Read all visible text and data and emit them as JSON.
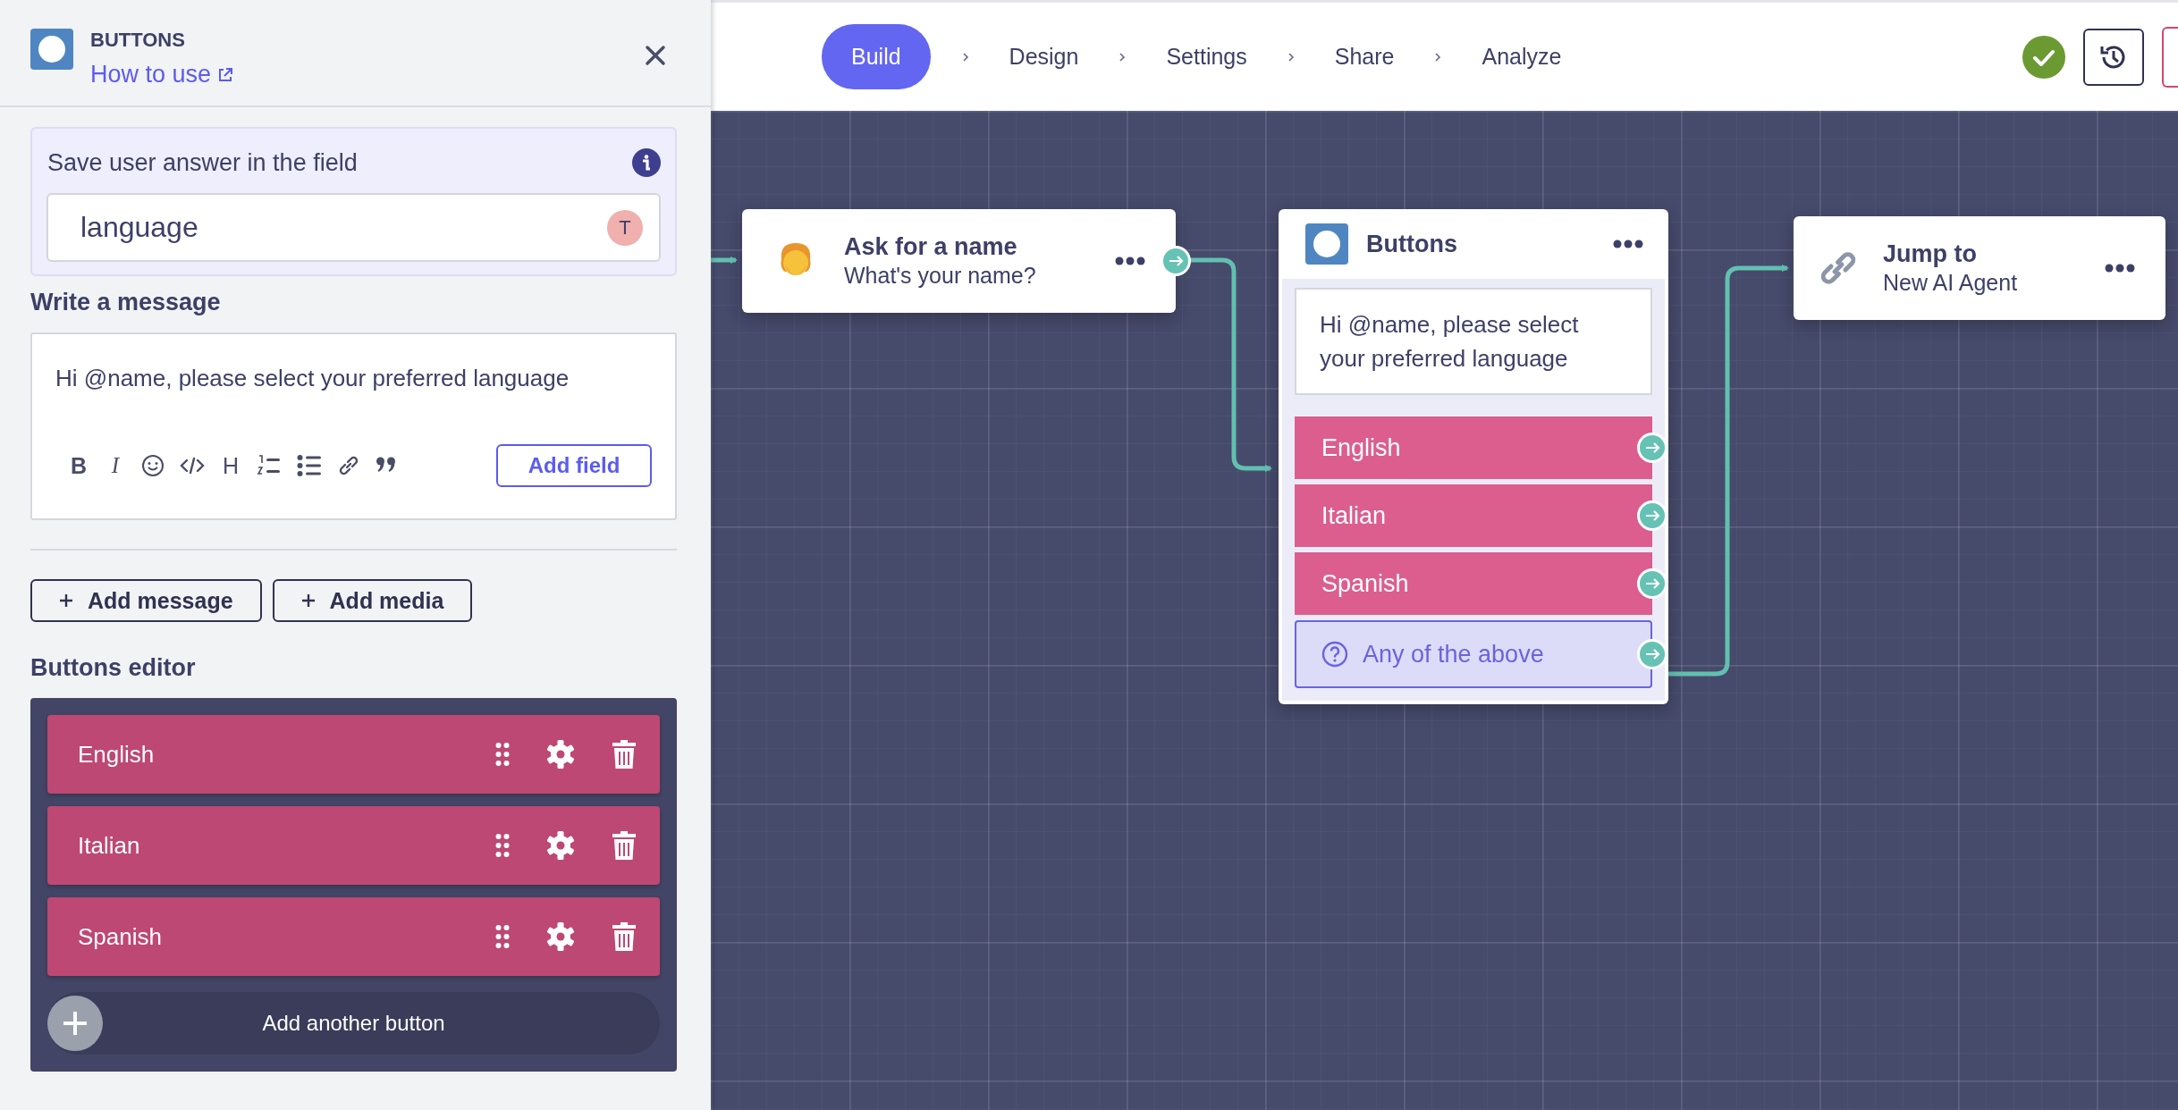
{
  "panel": {
    "title": "BUTTONS",
    "help_link": "How to use",
    "save_field": {
      "label": "Save user answer in the field",
      "value": "language",
      "type_badge": "T"
    },
    "message": {
      "title": "Write a message",
      "text": "Hi @name, please select your preferred language",
      "tools": [
        {
          "kind": "bold",
          "glyph": "B"
        },
        {
          "kind": "italic",
          "glyph": "I"
        },
        {
          "kind": "emoji"
        },
        {
          "kind": "code"
        },
        {
          "kind": "heading",
          "glyph": "H"
        },
        {
          "kind": "ordered-list"
        },
        {
          "kind": "bullet-list"
        },
        {
          "kind": "link"
        },
        {
          "kind": "quote"
        }
      ],
      "add_field": "Add field"
    },
    "actions": [
      "Add message",
      "Add media"
    ],
    "buttons_editor": {
      "title": "Buttons editor",
      "buttons": [
        {
          "label": "English"
        },
        {
          "label": "Italian"
        },
        {
          "label": "Spanish"
        }
      ],
      "add_button": "Add another button"
    }
  },
  "top_nav": {
    "steps": [
      {
        "label": "Build",
        "selected": true
      },
      {
        "label": "Design",
        "selected": false
      },
      {
        "label": "Settings",
        "selected": false
      },
      {
        "label": "Share",
        "selected": false
      },
      {
        "label": "Analyze",
        "selected": false
      }
    ]
  },
  "canvas": {
    "nodes": [
      {
        "kind": "input",
        "title": "Ask for a name",
        "subtitle": "What's your name?"
      },
      {
        "kind": "buttons",
        "title": "Buttons",
        "message": "Hi @name, please select your preferred language",
        "choices": [
          {
            "kind": "button",
            "label": "English"
          },
          {
            "kind": "button",
            "label": "Italian"
          },
          {
            "kind": "button",
            "label": "Spanish"
          },
          {
            "kind": "fallback",
            "label": "Any of the above"
          }
        ]
      },
      {
        "kind": "jump",
        "title": "Jump to",
        "subtitle": "New AI Agent"
      }
    ]
  }
}
